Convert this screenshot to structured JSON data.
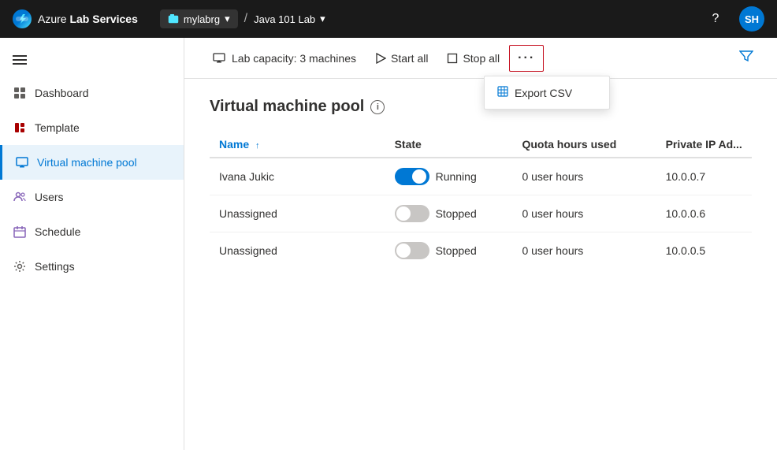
{
  "app": {
    "logo_text_normal": "Azure",
    "logo_text_bold": " Lab Services"
  },
  "nav": {
    "breadcrumb_group": "mylabrg",
    "separator": "/",
    "lab_name": "Java 101 Lab",
    "chevron": "▾",
    "help_icon": "?",
    "avatar_initials": "SH"
  },
  "sidebar": {
    "collapse_icon": "«",
    "items": [
      {
        "id": "dashboard",
        "label": "Dashboard",
        "icon": "grid"
      },
      {
        "id": "template",
        "label": "Template",
        "icon": "template"
      },
      {
        "id": "virtual-machine-pool",
        "label": "Virtual machine pool",
        "icon": "monitor",
        "active": true
      },
      {
        "id": "users",
        "label": "Users",
        "icon": "users"
      },
      {
        "id": "schedule",
        "label": "Schedule",
        "icon": "calendar"
      },
      {
        "id": "settings",
        "label": "Settings",
        "icon": "gear"
      }
    ]
  },
  "toolbar": {
    "capacity_icon": "monitor",
    "capacity_text": "Lab capacity: 3 machines",
    "start_all_label": "Start all",
    "stop_all_label": "Stop all",
    "more_label": "···",
    "filter_icon": "filter"
  },
  "dropdown": {
    "export_csv_label": "Export CSV",
    "export_csv_icon": "table"
  },
  "page": {
    "title": "Virtual machine pool",
    "info_icon": "i"
  },
  "table": {
    "columns": [
      "Name",
      "State",
      "Quota hours used",
      "Private IP Ad..."
    ],
    "rows": [
      {
        "name": "Ivana Jukic",
        "toggle": "on",
        "state": "Running",
        "quota": "0 user hours",
        "ip": "10.0.0.7"
      },
      {
        "name": "Unassigned",
        "toggle": "off",
        "state": "Stopped",
        "quota": "0 user hours",
        "ip": "10.0.0.6"
      },
      {
        "name": "Unassigned",
        "toggle": "off",
        "state": "Stopped",
        "quota": "0 user hours",
        "ip": "10.0.0.5"
      }
    ]
  }
}
